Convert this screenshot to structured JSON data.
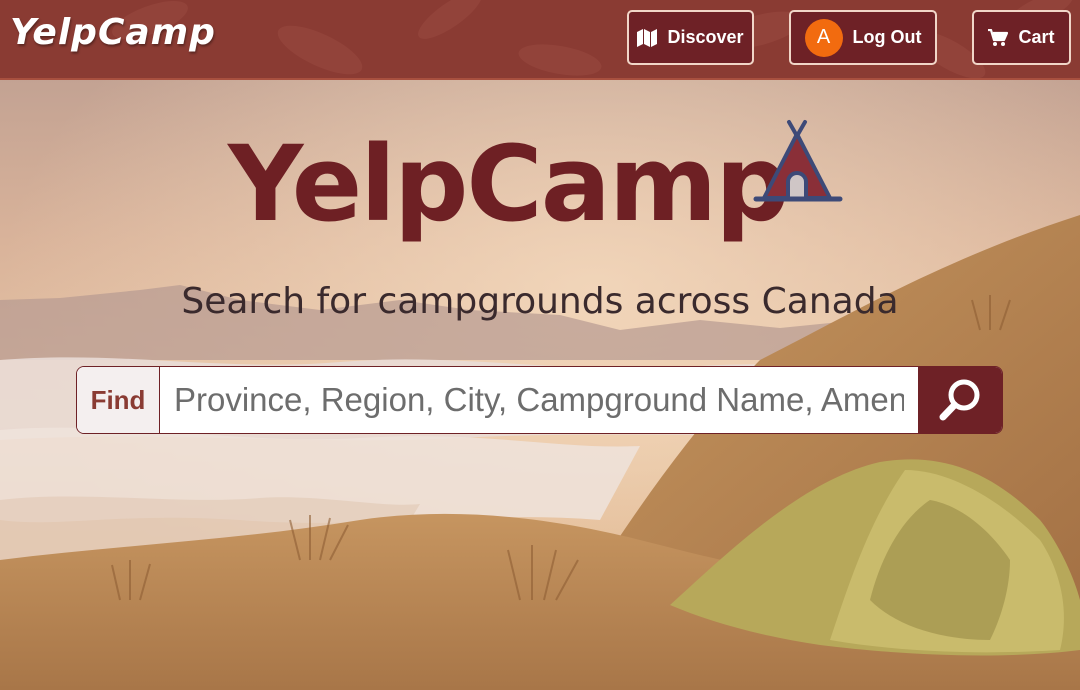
{
  "navbar": {
    "brand": "YelpCamp",
    "discover_label": "Discover",
    "discover_icon": "map-icon",
    "user_initial": "A",
    "logout_label": "Log Out",
    "cart_label": "Cart",
    "cart_icon": "cart-icon"
  },
  "hero": {
    "title": "YelpCamp",
    "logo_icon": "tent-icon",
    "subtitle": "Search for campgrounds across Canada"
  },
  "search": {
    "label": "Find",
    "placeholder": "Province, Region, City, Campground Name, Amenity, ...",
    "button_icon": "search-icon"
  },
  "colors": {
    "brand_maroon": "#6e2126",
    "navbar": "#8a3b33",
    "avatar": "#f26b0f"
  }
}
